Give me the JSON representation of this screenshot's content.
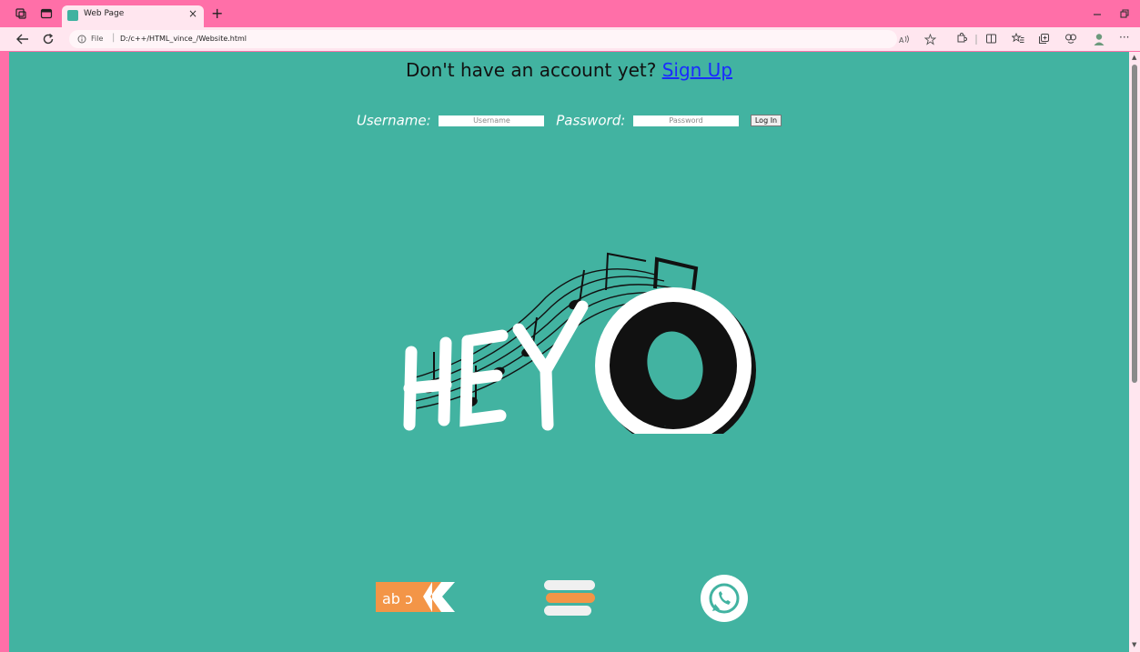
{
  "browser": {
    "tab_title": "Web Page",
    "tab_close": "×",
    "new_tab": "+",
    "url_file_label": "File",
    "url_separator": "|",
    "url": "D:/c++/HTML_vince_/Website.html",
    "more_label": "···"
  },
  "page": {
    "signup_prompt": "Don't have an account yet?",
    "signup_link": "Sign Up",
    "username_label": "Username:",
    "username_placeholder": "Username",
    "password_label": "Password:",
    "password_placeholder": "Password",
    "login_button": "Log In",
    "logo_text": "HEY",
    "about_icon_text": "ab ɔ"
  },
  "colors": {
    "tab_bar": "#ff6fa8",
    "address_bar": "#ffe6ef",
    "page_bg": "#42b3a1",
    "link": "#1a2bff",
    "orange": "#f39547"
  },
  "icons": [
    "workspaces-icon",
    "tab-actions-icon",
    "back-icon",
    "refresh-icon",
    "info-icon",
    "read-aloud-icon",
    "favorite-icon",
    "extensions-icon",
    "split-screen-icon",
    "favorites-icon",
    "collections-icon",
    "copilot-icon",
    "profile-icon",
    "about-icon",
    "menu-icon",
    "whatsapp-icon"
  ]
}
